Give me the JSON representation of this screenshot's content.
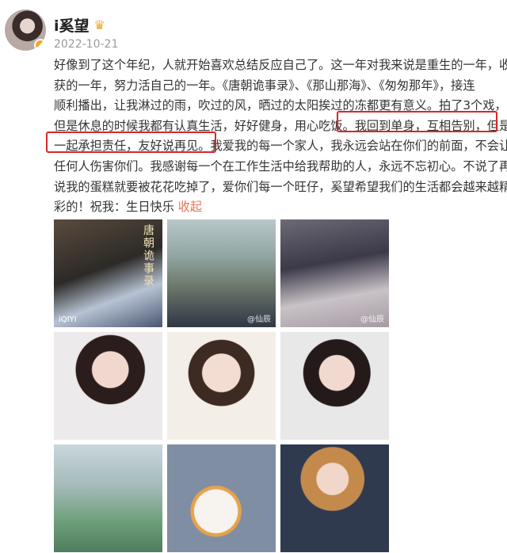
{
  "user": {
    "name": "i奚望",
    "date": "2022-10-21"
  },
  "post": {
    "lines": [
      "好像到了这个年纪，人就开始喜欢总结反应自己了。这一年对我来说是重生的一年，收",
      "获的一年，努力活自己的一年。《唐朝诡事录》、《那山那海》、《匆匆那年》，接连",
      "顺利播出，让我淋过的雨，吹过的风，晒过的太阳挨过的冻都更有意义。拍了3个戏，",
      "但是休息的时候我都有认真生活，好好健身，用心吃饭。我回到单身，互相告别，但是",
      "一起承担责任，友好说再见。我爱我的每一个家人，我永远会站在你们的前面，不会让",
      "任何人伤害你们。我感谢每一个在工作生活中给我帮助的人，永远不忘初心。不说了再",
      "说我的蛋糕就要被花花吃掉了，爱你们每一个旺仔，奚望希望我们的生活都会越来越精"
    ],
    "last_line": "彩的！祝我：生日快乐",
    "collapse": "收起"
  },
  "images": {
    "tile1_title": "唐朝诡事录",
    "tile1_logo": "iQIYI",
    "tile1_wm": "@仙辰",
    "tile2_wm": "@仙辰",
    "tile3_wm": "@仙辰"
  },
  "icons": {
    "verified": "verified-badge-icon",
    "crown": "crown-icon"
  },
  "colors": {
    "highlight": "#d9262a",
    "link": "#eb7350",
    "verified": "#f5a623"
  }
}
